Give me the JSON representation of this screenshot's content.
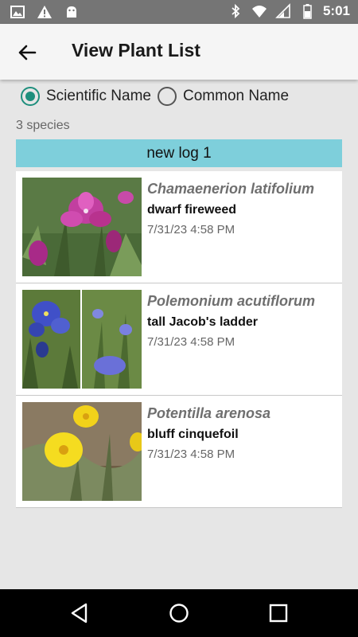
{
  "status_bar": {
    "time": "5:01",
    "icons_left": [
      "image-notification-icon",
      "warning-icon",
      "android-icon"
    ],
    "icons_right": [
      "bluetooth-icon",
      "wifi-icon",
      "signal-icon",
      "battery-icon"
    ]
  },
  "app_bar": {
    "title": "View Plant List",
    "back_icon": "arrow-left-icon"
  },
  "sort_options": {
    "scientific_label": "Scientific Name",
    "common_label": "Common Name",
    "selected": "scientific"
  },
  "species_count": "3 species",
  "log_name": "new log 1",
  "plants": [
    {
      "scientific_name": "Chamaenerion latifolium",
      "common_name": "dwarf fireweed",
      "date": "7/31/23 4:58 PM"
    },
    {
      "scientific_name": "Polemonium acutiflorum",
      "common_name": "tall Jacob's ladder",
      "date": "7/31/23 4:58 PM"
    },
    {
      "scientific_name": "Potentilla arenosa",
      "common_name": "bluff cinquefoil",
      "date": "7/31/23 4:58 PM"
    }
  ],
  "colors": {
    "accent": "#1e8f7d",
    "log_header_bg": "#7ecfdb",
    "status_bar_bg": "#757575"
  },
  "nav_bar": {
    "back_icon": "triangle-back-icon",
    "home_icon": "circle-home-icon",
    "recents_icon": "square-recents-icon"
  }
}
